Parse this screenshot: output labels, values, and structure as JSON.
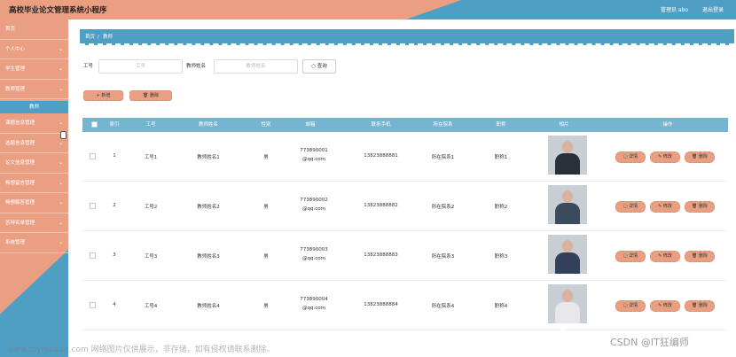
{
  "app": {
    "title": "高校毕业论文管理系统小程序",
    "user": "管理员 abo",
    "logout": "退出登录"
  },
  "sidebar": {
    "items": [
      {
        "label": "首页",
        "chev": ""
      },
      {
        "label": "个人中心",
        "chev": "⌄"
      },
      {
        "label": "学生管理",
        "chev": "⌄"
      },
      {
        "label": "教师管理",
        "chev": "⌄"
      },
      {
        "label": "课题信息管理",
        "chev": "⌄"
      },
      {
        "label": "选题信息管理",
        "chev": "⌄"
      },
      {
        "label": "论文信息管理",
        "chev": "⌄"
      },
      {
        "label": "畅想留言管理",
        "chev": "⌄"
      },
      {
        "label": "畅想解答管理",
        "chev": "⌄"
      },
      {
        "label": "答辩名单管理",
        "chev": "⌄"
      },
      {
        "label": "系统管理",
        "chev": "⌄"
      }
    ],
    "submenu": "教师"
  },
  "breadcrumb": {
    "home": "首页",
    "sep": "/",
    "current": "教师"
  },
  "search": {
    "id_label": "工号",
    "id_placeholder": "工号",
    "name_label": "教师姓名",
    "name_placeholder": "教师姓名",
    "query": "查询"
  },
  "actions": {
    "add": "+ 新增",
    "delete": "🗑 删除"
  },
  "table": {
    "headers": [
      "索引",
      "工号",
      "教师姓名",
      "性别",
      "邮箱",
      "联系手机",
      "所在院系",
      "职称",
      "相片",
      "操作"
    ],
    "rows": [
      {
        "idx": "1",
        "id": "工号1",
        "name": "教师姓名1",
        "gender": "男",
        "email": "773890001@qq.com",
        "phone": "13823888881",
        "dept": "所在院系1",
        "title": "职称1"
      },
      {
        "idx": "2",
        "id": "工号2",
        "name": "教师姓名2",
        "gender": "男",
        "email": "773890002@qq.com",
        "phone": "13823888882",
        "dept": "所在院系2",
        "title": "职称2"
      },
      {
        "idx": "3",
        "id": "工号3",
        "name": "教师姓名3",
        "gender": "男",
        "email": "773890003@qq.com",
        "phone": "13823888883",
        "dept": "所在院系3",
        "title": "职称3"
      },
      {
        "idx": "4",
        "id": "工号4",
        "name": "教师姓名4",
        "gender": "男",
        "email": "773890004@qq.com",
        "phone": "13823888884",
        "dept": "所在院系4",
        "title": "职称4"
      }
    ],
    "ops": {
      "detail": "详情",
      "edit": "修改",
      "remove": "删除"
    }
  },
  "watermarks": {
    "left": "www.toymoban.com 网络图片仅供展示，非存储，如有侵权请联系删除。",
    "right": "CSDN @IT狂编师"
  },
  "colors": {
    "salmon": "#eb9f82",
    "blue": "#4f9fc4"
  }
}
